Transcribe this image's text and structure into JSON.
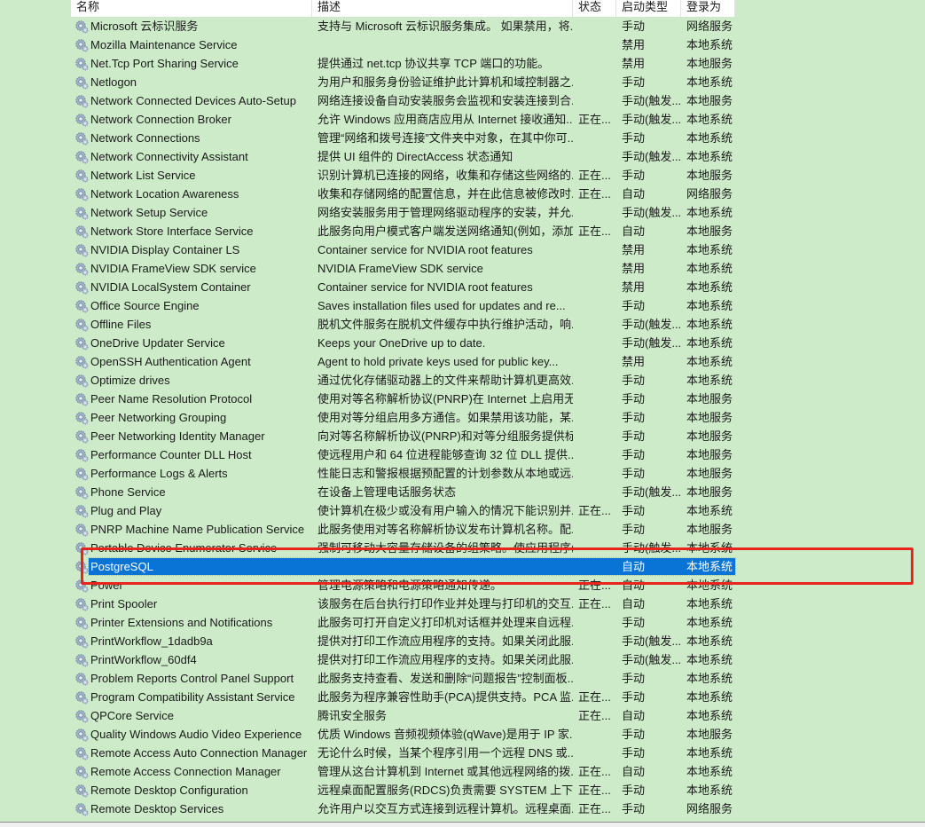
{
  "columns": {
    "name": "名称",
    "description": "描述",
    "status": "状态",
    "startup_type": "启动类型",
    "log_on_as": "登录为"
  },
  "selected_service": "PostgreSQL",
  "services": [
    {
      "name": "Microsoft 云标识服务",
      "description": "支持与 Microsoft 云标识服务集成。 如果禁用，将...",
      "status": "",
      "startup": "手动",
      "logon": "网络服务"
    },
    {
      "name": "Mozilla Maintenance Service",
      "description": "",
      "status": "",
      "startup": "禁用",
      "logon": "本地系统"
    },
    {
      "name": "Net.Tcp Port Sharing Service",
      "description": "提供通过 net.tcp 协议共享 TCP 端口的功能。",
      "status": "",
      "startup": "禁用",
      "logon": "本地服务"
    },
    {
      "name": "Netlogon",
      "description": "为用户和服务身份验证维护此计算机和域控制器之...",
      "status": "",
      "startup": "手动",
      "logon": "本地系统"
    },
    {
      "name": "Network Connected Devices Auto-Setup",
      "description": "网络连接设备自动安装服务会监视和安装连接到合...",
      "status": "",
      "startup": "手动(触发...",
      "logon": "本地服务"
    },
    {
      "name": "Network Connection Broker",
      "description": "允许 Windows 应用商店应用从 Internet 接收通知...",
      "status": "正在...",
      "startup": "手动(触发...",
      "logon": "本地系统"
    },
    {
      "name": "Network Connections",
      "description": "管理“网络和拨号连接”文件夹中对象，在其中你可...",
      "status": "",
      "startup": "手动",
      "logon": "本地系统"
    },
    {
      "name": "Network Connectivity Assistant",
      "description": "提供 UI 组件的 DirectAccess 状态通知",
      "status": "",
      "startup": "手动(触发...",
      "logon": "本地系统"
    },
    {
      "name": "Network List Service",
      "description": "识别计算机已连接的网络，收集和存储这些网络的...",
      "status": "正在...",
      "startup": "手动",
      "logon": "本地服务"
    },
    {
      "name": "Network Location Awareness",
      "description": "收集和存储网络的配置信息，并在此信息被修改时...",
      "status": "正在...",
      "startup": "自动",
      "logon": "网络服务"
    },
    {
      "name": "Network Setup Service",
      "description": "网络安装服务用于管理网络驱动程序的安装，并允...",
      "status": "",
      "startup": "手动(触发...",
      "logon": "本地系统"
    },
    {
      "name": "Network Store Interface Service",
      "description": "此服务向用户模式客户端发送网络通知(例如，添加/...",
      "status": "正在...",
      "startup": "自动",
      "logon": "本地服务"
    },
    {
      "name": "NVIDIA Display Container LS",
      "description": "Container service for NVIDIA root features",
      "status": "",
      "startup": "禁用",
      "logon": "本地系统"
    },
    {
      "name": "NVIDIA FrameView SDK service",
      "description": "NVIDIA FrameView SDK service",
      "status": "",
      "startup": "禁用",
      "logon": "本地系统"
    },
    {
      "name": "NVIDIA LocalSystem Container",
      "description": "Container service for NVIDIA root features",
      "status": "",
      "startup": "禁用",
      "logon": "本地系统"
    },
    {
      "name": "Office  Source Engine",
      "description": "Saves installation files used for updates and re...",
      "status": "",
      "startup": "手动",
      "logon": "本地系统"
    },
    {
      "name": "Offline Files",
      "description": "脱机文件服务在脱机文件缓存中执行维护活动，响...",
      "status": "",
      "startup": "手动(触发...",
      "logon": "本地系统"
    },
    {
      "name": "OneDrive Updater Service",
      "description": "Keeps your OneDrive up to date.",
      "status": "",
      "startup": "手动(触发...",
      "logon": "本地系统"
    },
    {
      "name": "OpenSSH Authentication Agent",
      "description": "Agent to hold private keys used for public key...",
      "status": "",
      "startup": "禁用",
      "logon": "本地系统"
    },
    {
      "name": "Optimize drives",
      "description": "通过优化存储驱动器上的文件来帮助计算机更高效...",
      "status": "",
      "startup": "手动",
      "logon": "本地系统"
    },
    {
      "name": "Peer Name Resolution Protocol",
      "description": "使用对等名称解析协议(PNRP)在 Internet 上启用无...",
      "status": "",
      "startup": "手动",
      "logon": "本地服务"
    },
    {
      "name": "Peer Networking Grouping",
      "description": "使用对等分组启用多方通信。如果禁用该功能，某...",
      "status": "",
      "startup": "手动",
      "logon": "本地服务"
    },
    {
      "name": "Peer Networking Identity Manager",
      "description": "向对等名称解析协议(PNRP)和对等分组服务提供标...",
      "status": "",
      "startup": "手动",
      "logon": "本地服务"
    },
    {
      "name": "Performance Counter DLL Host",
      "description": "使远程用户和 64 位进程能够查询 32 位 DLL 提供...",
      "status": "",
      "startup": "手动",
      "logon": "本地服务"
    },
    {
      "name": "Performance Logs & Alerts",
      "description": "性能日志和警报根据预配置的计划参数从本地或远...",
      "status": "",
      "startup": "手动",
      "logon": "本地服务"
    },
    {
      "name": "Phone Service",
      "description": "在设备上管理电话服务状态",
      "status": "",
      "startup": "手动(触发...",
      "logon": "本地服务"
    },
    {
      "name": "Plug and Play",
      "description": "使计算机在极少或没有用户输入的情况下能识别并...",
      "status": "正在...",
      "startup": "手动",
      "logon": "本地系统"
    },
    {
      "name": "PNRP Machine Name Publication Service",
      "description": "此服务使用对等名称解析协议发布计算机名称。配...",
      "status": "",
      "startup": "手动",
      "logon": "本地服务"
    },
    {
      "name": "Portable Device Enumerator Service",
      "description": "强制可移动大容量存储设备的组策略。使应用程序(...",
      "status": "",
      "startup": "手动(触发...",
      "logon": "本地系统"
    },
    {
      "name": "PostgreSQL",
      "description": "",
      "status": "",
      "startup": "自动",
      "logon": "本地系统",
      "selected": true
    },
    {
      "name": "Power",
      "description": "管理电源策略和电源策略通知传递。",
      "status": "正在...",
      "startup": "自动",
      "logon": "本地系统"
    },
    {
      "name": "Print Spooler",
      "description": "该服务在后台执行打印作业并处理与打印机的交互...",
      "status": "正在...",
      "startup": "自动",
      "logon": "本地系统"
    },
    {
      "name": "Printer Extensions and Notifications",
      "description": "此服务可打开自定义打印机对话框并处理来自远程...",
      "status": "",
      "startup": "手动",
      "logon": "本地系统"
    },
    {
      "name": "PrintWorkflow_1dadb9a",
      "description": "提供对打印工作流应用程序的支持。如果关闭此服...",
      "status": "",
      "startup": "手动(触发...",
      "logon": "本地系统"
    },
    {
      "name": "PrintWorkflow_60df4",
      "description": "提供对打印工作流应用程序的支持。如果关闭此服...",
      "status": "",
      "startup": "手动(触发...",
      "logon": "本地系统"
    },
    {
      "name": "Problem Reports Control Panel Support",
      "description": "此服务支持查看、发送和删除“问题报告”控制面板...",
      "status": "",
      "startup": "手动",
      "logon": "本地系统"
    },
    {
      "name": "Program Compatibility Assistant Service",
      "description": "此服务为程序兼容性助手(PCA)提供支持。PCA 监...",
      "status": "正在...",
      "startup": "手动",
      "logon": "本地系统"
    },
    {
      "name": "QPCore Service",
      "description": "腾讯安全服务",
      "status": "正在...",
      "startup": "自动",
      "logon": "本地系统"
    },
    {
      "name": "Quality Windows Audio Video Experience",
      "description": "优质 Windows 音频视频体验(qWave)是用于 IP 家...",
      "status": "",
      "startup": "手动",
      "logon": "本地服务"
    },
    {
      "name": "Remote Access Auto Connection Manager",
      "description": "无论什么时候，当某个程序引用一个远程 DNS 或...",
      "status": "",
      "startup": "手动",
      "logon": "本地系统"
    },
    {
      "name": "Remote Access Connection Manager",
      "description": "管理从这台计算机到 Internet 或其他远程网络的拨...",
      "status": "正在...",
      "startup": "自动",
      "logon": "本地系统"
    },
    {
      "name": "Remote Desktop Configuration",
      "description": "远程桌面配置服务(RDCS)负责需要 SYSTEM 上下...",
      "status": "正在...",
      "startup": "手动",
      "logon": "本地系统"
    },
    {
      "name": "Remote Desktop Services",
      "description": "允许用户以交互方式连接到远程计算机。远程桌面...",
      "status": "正在...",
      "startup": "手动",
      "logon": "网络服务"
    }
  ],
  "colors": {
    "background": "#cdebc9",
    "selection": "#0a74d6",
    "annotation_box": "#e8251c"
  }
}
